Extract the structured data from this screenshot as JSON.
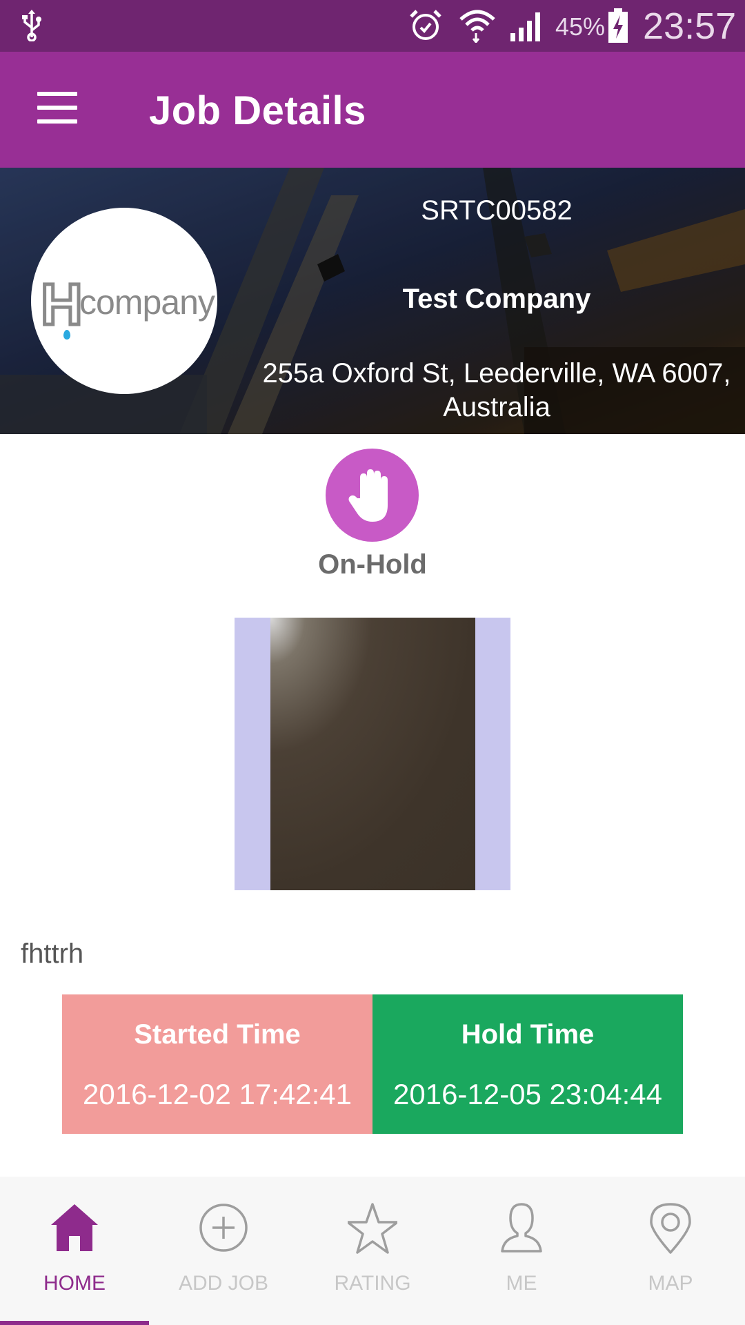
{
  "status_bar": {
    "battery_percent": "45%",
    "time": "23:57",
    "icons": [
      "usb-icon",
      "alarm-icon",
      "wifi-icon",
      "signal-icon",
      "battery-charging-icon"
    ]
  },
  "app_bar": {
    "title": "Job Details",
    "menu_icon": "hamburger-menu-icon"
  },
  "header": {
    "logo_letter": "H",
    "logo_word": "company",
    "job_id": "SRTC00582",
    "company_name": "Test Company",
    "address": "255a Oxford St, Leederville, WA 6007, Australia"
  },
  "job_status": {
    "icon": "hand-stop-icon",
    "label": "On-Hold",
    "color": "#c85ac6"
  },
  "note": "fhttrh",
  "times": {
    "started": {
      "title": "Started Time",
      "value": "2016-12-02 17:42:41",
      "color": "#f29c9a"
    },
    "hold": {
      "title": "Hold Time",
      "value": "2016-12-05 23:04:44",
      "color": "#1aa85e"
    }
  },
  "bottom_nav": {
    "active_color": "#8e2b8c",
    "items": [
      {
        "label": "HOME",
        "icon": "home-icon",
        "active": true
      },
      {
        "label": "ADD JOB",
        "icon": "plus-circle-icon",
        "active": false
      },
      {
        "label": "RATING",
        "icon": "star-icon",
        "active": false
      },
      {
        "label": "ME",
        "icon": "person-icon",
        "active": false
      },
      {
        "label": "MAP",
        "icon": "map-pin-icon",
        "active": false
      }
    ]
  },
  "colors": {
    "status_bar": "#6f2570",
    "app_bar": "#982f95",
    "photo_frame": "#c8c6ee"
  }
}
